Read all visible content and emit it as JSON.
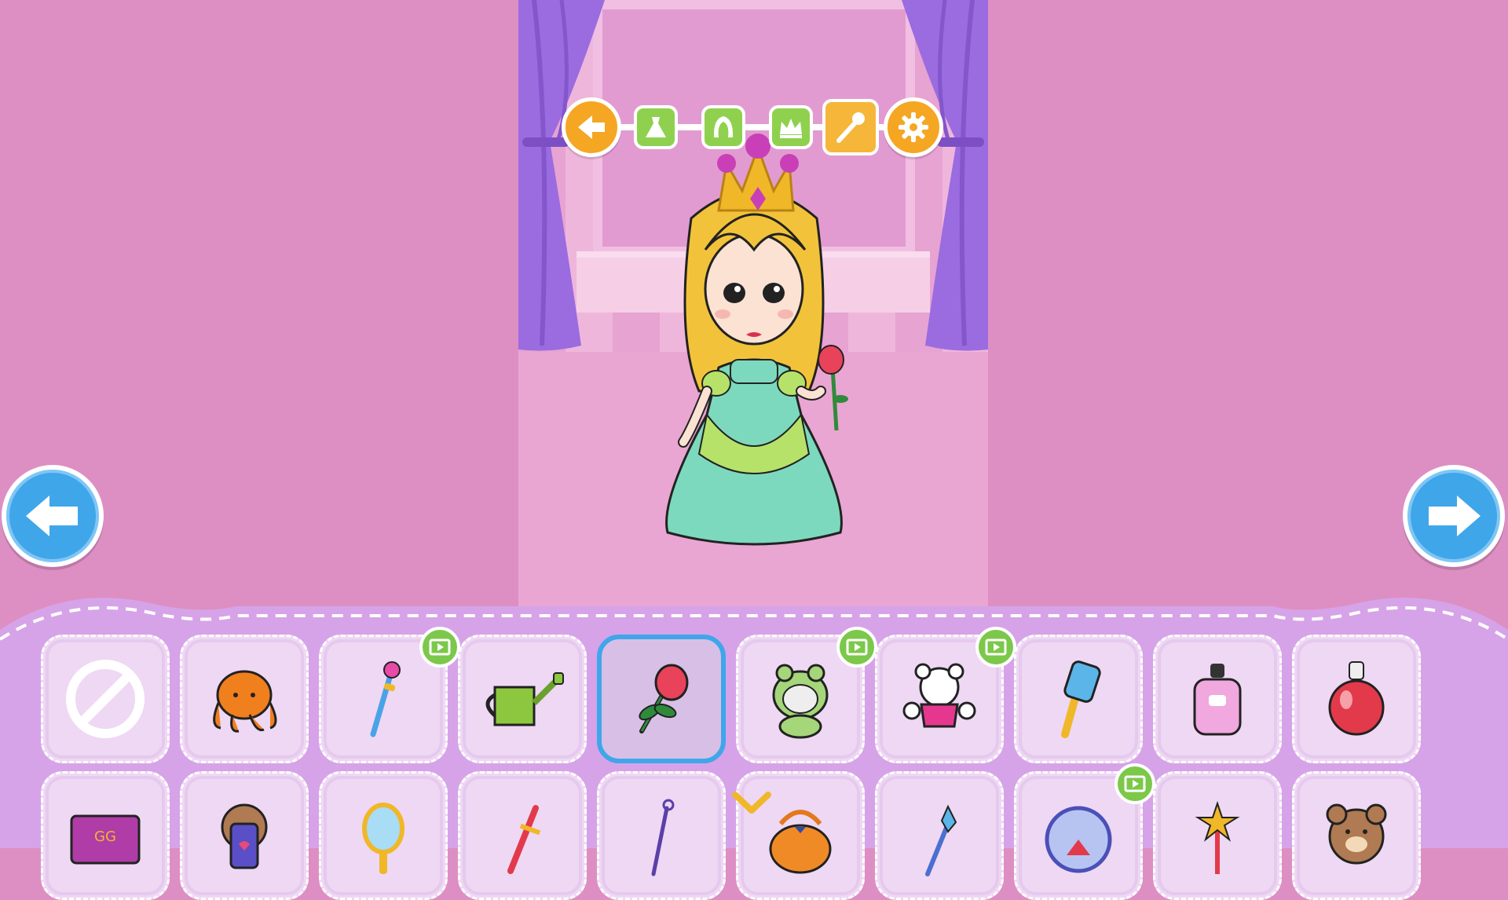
{
  "toolbar": {
    "buttons": [
      {
        "id": "back",
        "icon": "back-arrow-icon"
      },
      {
        "id": "dress",
        "icon": "dress-icon"
      },
      {
        "id": "hair",
        "icon": "hair-icon"
      },
      {
        "id": "crown",
        "icon": "crown-icon"
      },
      {
        "id": "accessory",
        "icon": "wand-icon",
        "active": true
      },
      {
        "id": "settings",
        "icon": "gear-icon"
      }
    ]
  },
  "colors": {
    "background": "#dd8fc3",
    "panel": "#d6a3e8",
    "slot": "#eed8f3",
    "accent_blue": "#3fa6ea",
    "accent_orange": "#f5a623",
    "badge_green": "#7cc84a"
  },
  "items_row1": [
    {
      "icon": "none-icon",
      "video": false,
      "selected": false
    },
    {
      "icon": "octopus-plush-icon",
      "video": false,
      "selected": false
    },
    {
      "icon": "magic-wand-icon",
      "video": true,
      "selected": false
    },
    {
      "icon": "watering-can-icon",
      "video": false,
      "selected": false
    },
    {
      "icon": "rose-icon",
      "video": false,
      "selected": true
    },
    {
      "icon": "frog-hood-cat-icon",
      "video": true,
      "selected": false
    },
    {
      "icon": "teddy-bear-white-icon",
      "video": true,
      "selected": false
    },
    {
      "icon": "comb-icon",
      "video": false,
      "selected": false
    },
    {
      "icon": "perfume-pink-icon",
      "video": false,
      "selected": false
    },
    {
      "icon": "perfume-red-icon",
      "video": false,
      "selected": false
    }
  ],
  "items_row2": [
    {
      "icon": "purse-icon",
      "video": false
    },
    {
      "icon": "bear-phone-icon",
      "video": false
    },
    {
      "icon": "hand-mirror-icon",
      "video": false
    },
    {
      "icon": "sword-icon",
      "video": false
    },
    {
      "icon": "staff-icon",
      "video": false
    },
    {
      "icon": "pumpkin-bag-icon",
      "video": false,
      "checked": true
    },
    {
      "icon": "crystal-wand-icon",
      "video": false
    },
    {
      "icon": "snow-globe-icon",
      "video": true
    },
    {
      "icon": "star-wand-icon",
      "video": false
    },
    {
      "icon": "brown-bear-icon",
      "video": false
    }
  ]
}
